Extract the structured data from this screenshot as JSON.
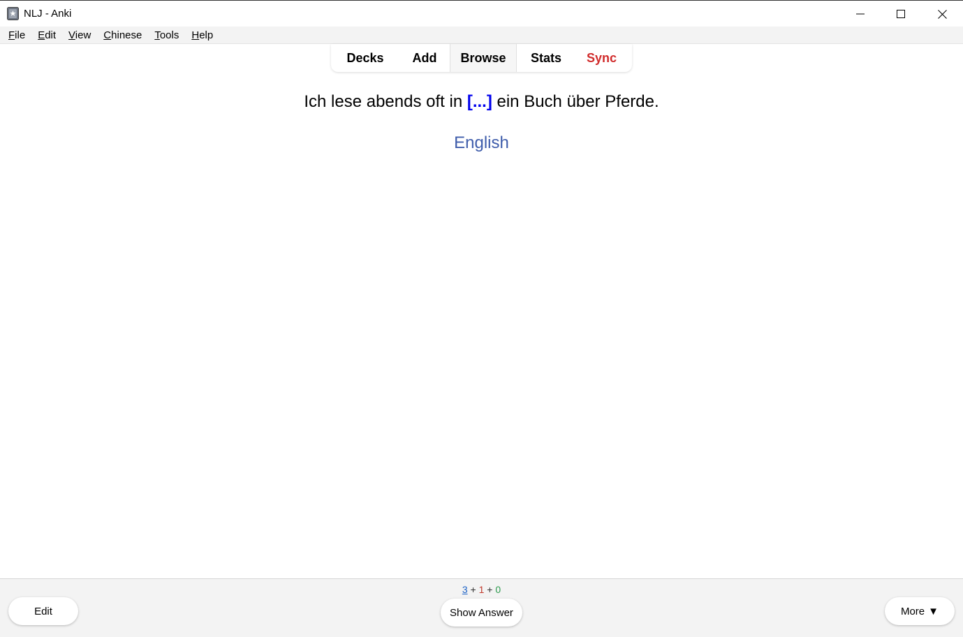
{
  "window": {
    "title": "NLJ - Anki"
  },
  "menu": {
    "items": [
      {
        "mnemonic": "F",
        "rest": "ile"
      },
      {
        "mnemonic": "E",
        "rest": "dit"
      },
      {
        "mnemonic": "V",
        "rest": "iew"
      },
      {
        "mnemonic": "C",
        "rest": "hinese"
      },
      {
        "mnemonic": "T",
        "rest": "ools"
      },
      {
        "mnemonic": "H",
        "rest": "elp"
      }
    ]
  },
  "toolbar": {
    "decks": "Decks",
    "add": "Add",
    "browse": "Browse",
    "stats": "Stats",
    "sync": "Sync"
  },
  "card": {
    "before_cloze": "Ich lese abends oft in ",
    "cloze": "[...]",
    "after_cloze": " ein Buch über Pferde.",
    "language": "English"
  },
  "counts": {
    "new": "3",
    "learn": "1",
    "review": "0",
    "separator": "+"
  },
  "bottom": {
    "edit": "Edit",
    "show_answer": "Show Answer",
    "more": "More",
    "more_arrow": "▼"
  },
  "colors": {
    "sync": "#d12c2c",
    "cloze": "#0000ee",
    "language": "#3f5dab",
    "count_new": "#1e63c6",
    "count_learn": "#c0392b",
    "count_review": "#2e9b4f"
  }
}
